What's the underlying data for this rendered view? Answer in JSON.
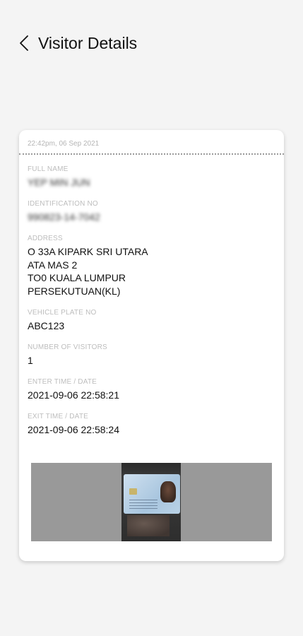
{
  "header": {
    "title": "Visitor Details",
    "back_icon": "chevron-left-icon"
  },
  "card": {
    "timestamp": "22:42pm, 06 Sep 2021",
    "fields": [
      {
        "label": "FULL NAME",
        "value": "YEP MIN JUN",
        "blurred": true
      },
      {
        "label": "IDENTIFICATION NO",
        "value": "990823-14-7042",
        "blurred": true
      },
      {
        "label": "ADDRESS",
        "value": "O 33A KIPARK SRI UTARA\nATA MAS 2\nTO0 KUALA LUMPUR\nPERSEKUTUAN(KL)"
      },
      {
        "label": "VEHICLE PLATE NO",
        "value": "ABC123"
      },
      {
        "label": "NUMBER OF VISITORS",
        "value": "1"
      },
      {
        "label": "ENTER TIME / DATE",
        "value": "2021-09-06 22:58:21"
      },
      {
        "label": "EXIT TIME / DATE",
        "value": "2021-09-06 22:58:24"
      }
    ]
  },
  "colors": {
    "background": "#f4f4f4",
    "label": "#bdbdbd",
    "photo_background": "#999999"
  }
}
